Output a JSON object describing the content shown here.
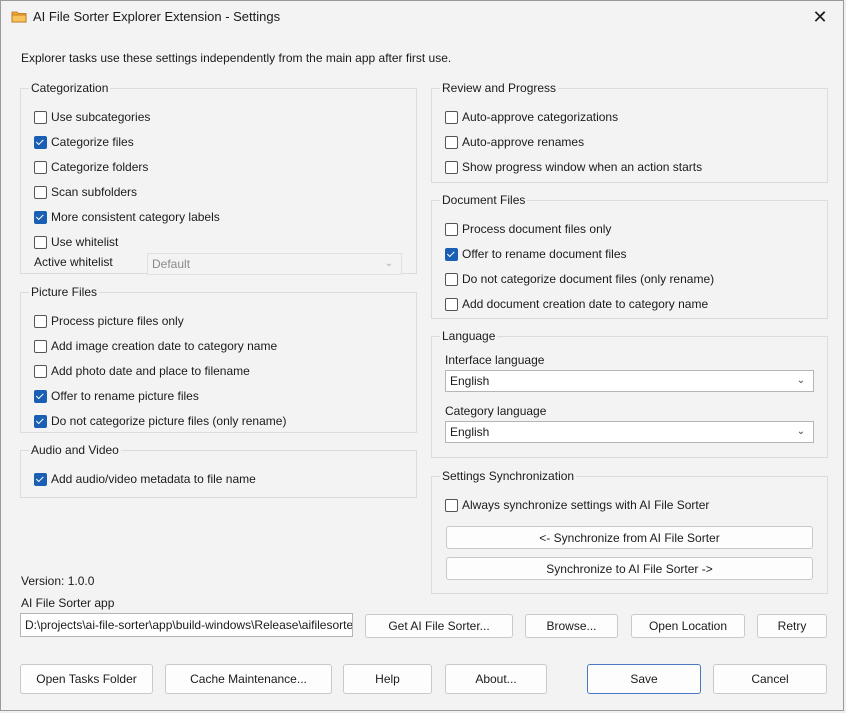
{
  "window": {
    "title": "AI File Sorter Explorer Extension - Settings",
    "close_glyph": "✕"
  },
  "intro_text": "Explorer tasks use these settings independently from the main app after first use.",
  "categorization": {
    "title": "Categorization",
    "options": [
      {
        "label": "Use subcategories",
        "checked": false
      },
      {
        "label": "Categorize files",
        "checked": true
      },
      {
        "label": "Categorize folders",
        "checked": false
      },
      {
        "label": "Scan subfolders",
        "checked": false
      },
      {
        "label": "More consistent category labels",
        "checked": true
      },
      {
        "label": "Use whitelist",
        "checked": false
      }
    ],
    "active_whitelist_label": "Active whitelist",
    "active_whitelist_value": "Default"
  },
  "picture_files": {
    "title": "Picture Files",
    "options": [
      {
        "label": "Process picture files only",
        "checked": false
      },
      {
        "label": "Add image creation date to category name",
        "checked": false
      },
      {
        "label": "Add photo date and place to filename",
        "checked": false
      },
      {
        "label": "Offer to rename picture files",
        "checked": true
      },
      {
        "label": "Do not categorize picture files (only rename)",
        "checked": true
      }
    ]
  },
  "audio_video": {
    "title": "Audio and Video",
    "options": [
      {
        "label": "Add audio/video metadata to file name",
        "checked": true
      }
    ]
  },
  "review_progress": {
    "title": "Review and Progress",
    "options": [
      {
        "label": "Auto-approve categorizations",
        "checked": false
      },
      {
        "label": "Auto-approve renames",
        "checked": false
      },
      {
        "label": "Show progress window when an action starts",
        "checked": false
      }
    ]
  },
  "document_files": {
    "title": "Document Files",
    "options": [
      {
        "label": "Process document files only",
        "checked": false
      },
      {
        "label": "Offer to rename document files",
        "checked": true
      },
      {
        "label": "Do not categorize document files (only rename)",
        "checked": false
      },
      {
        "label": "Add document creation date to category name",
        "checked": false
      }
    ]
  },
  "language": {
    "title": "Language",
    "interface_label": "Interface language",
    "interface_value": "English",
    "category_label": "Category language",
    "category_value": "English"
  },
  "sync": {
    "title": "Settings Synchronization",
    "always_sync": {
      "label": "Always synchronize settings with AI File Sorter",
      "checked": false
    },
    "from_button": "<- Synchronize from AI File Sorter",
    "to_button": "Synchronize to AI File Sorter ->"
  },
  "version_text": "Version: 1.0.0",
  "app_path": {
    "label": "AI File Sorter app",
    "value": "D:\\projects\\ai-file-sorter\\app\\build-windows\\Release\\aifilesorter.exe",
    "get_button": "Get AI File Sorter...",
    "browse_button": "Browse...",
    "open_location_button": "Open Location",
    "retry_button": "Retry"
  },
  "footer": {
    "open_tasks": "Open Tasks Folder",
    "cache": "Cache Maintenance...",
    "help": "Help",
    "about": "About...",
    "save": "Save",
    "cancel": "Cancel"
  },
  "colors": {
    "accent": "#1a5fb4",
    "window_bg": "#f3f3f3",
    "icon_folder": "#f2a93b"
  }
}
